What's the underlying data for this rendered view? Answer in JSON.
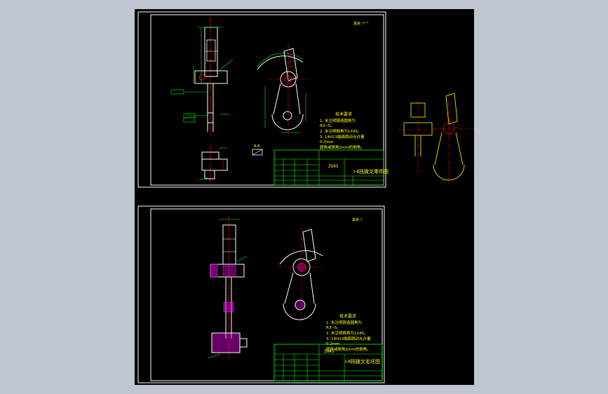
{
  "sheet1": {
    "corner_note": "其余 ▽⁶·³",
    "notes_title": "技术要求",
    "notes": [
      "1. 未注明铸造圆角为",
      "R3~5。",
      "2. 未注明倒角为1X45。",
      "3. 14H13端面跳动允许量",
      "0.2mm",
      "圆角或倒角2mm的倒角。"
    ],
    "section_label": "B-B",
    "part_no": "ZG45",
    "title_block_name": "Ⅰ-Ⅱ挡拨叉零件图"
  },
  "sheet2": {
    "corner_note": "其余 ▽",
    "notes_title": "技术要求",
    "notes": [
      "1. 未注明铸造圆角为",
      "R3~5。",
      "2. 未注明倒角为1X45。",
      "3. 14H13端面跳动允许量",
      "0.2mm",
      "圆角或倒角2mm的倒角。"
    ],
    "part_no": "ZG45",
    "title_block_name": "Ⅰ-Ⅱ挡拨叉毛坯图"
  },
  "colors": {
    "background": "#000000",
    "frame": "#ffffff",
    "dimension": "#00ff00",
    "centerline": "#ff0000",
    "outline": "#ffffff",
    "text": "#ffff00",
    "hatch": "#ff00ff",
    "ui_gray": "#bfc6cf"
  }
}
